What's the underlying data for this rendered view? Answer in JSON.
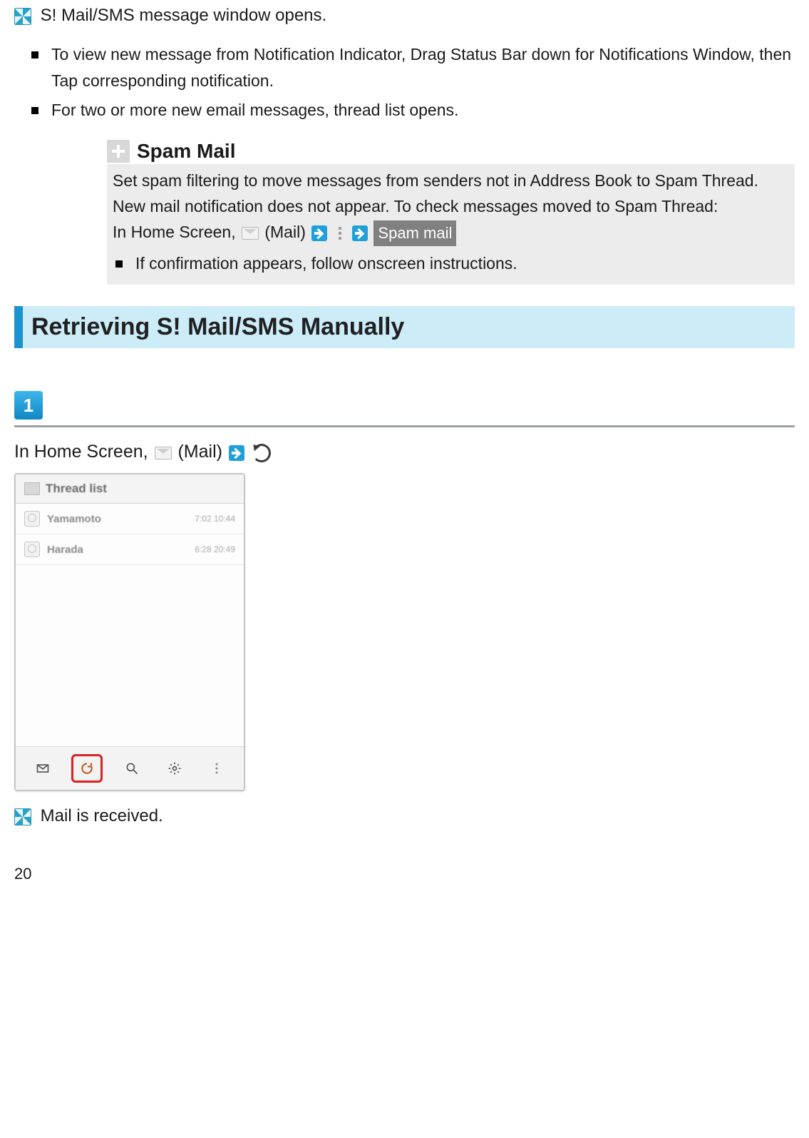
{
  "intro": {
    "result_line": "S! Mail/SMS message window opens.",
    "bullets": [
      "To view new message from Notification Indicator, Drag Status Bar down for Notifications Window, then Tap corresponding notification.",
      "For two or more new email messages, thread list opens."
    ]
  },
  "tip": {
    "title": "Spam Mail",
    "body_line1": "Set spam filtering to move messages from senders not in Address Book to Spam Thread. New mail notification does not appear. To check messages moved to Spam Thread:",
    "path_prefix": "In Home Screen, ",
    "path_mail_label": " (Mail)",
    "spam_button_label": "Spam mail",
    "sub_bullets": [
      "If confirmation appears, follow onscreen instructions."
    ]
  },
  "section": {
    "heading": "Retrieving S! Mail/SMS Manually"
  },
  "step1": {
    "number": "1",
    "text_prefix": "In Home Screen, ",
    "text_mail_label": " (Mail)"
  },
  "phone": {
    "header": "Thread list",
    "rows": [
      {
        "name": "Yamamoto",
        "time": "7:02 10:44"
      },
      {
        "name": "Harada",
        "time": "6:28 20:49"
      }
    ]
  },
  "step1_result": "Mail is received.",
  "page_number": "20"
}
